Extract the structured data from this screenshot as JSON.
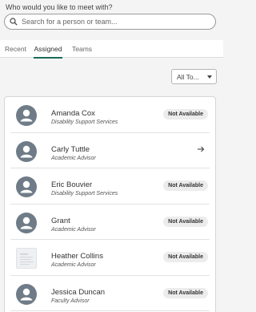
{
  "header": {
    "question": "Who would you like to meet with?"
  },
  "search": {
    "placeholder": "Search for a person or team...",
    "icon": "search-icon"
  },
  "tabs": [
    {
      "label": "Recent",
      "active": false
    },
    {
      "label": "Assigned",
      "active": true
    },
    {
      "label": "Teams",
      "active": false
    }
  ],
  "filter": {
    "value": "All To..."
  },
  "colors": {
    "accent": "#1a6a5a",
    "avatar": "#6f7c88",
    "badge_bg": "#ececec"
  },
  "people": [
    {
      "name": "Amanda Cox",
      "role": "Disability Support Services",
      "status": "Not Available",
      "avatar": "person-icon"
    },
    {
      "name": "Carly Tuttle",
      "role": "Academic Advisor",
      "status": "",
      "action_icon": "arrow-right-icon",
      "avatar": "person-icon"
    },
    {
      "name": "Eric Bouvier",
      "role": "Disability Support Services",
      "status": "Not Available",
      "avatar": "person-icon"
    },
    {
      "name": "Grant",
      "role": "Academic Advisor",
      "status": "Not Available",
      "avatar": "person-icon"
    },
    {
      "name": "Heather Collins",
      "role": "Academic Advisor",
      "status": "Not Available",
      "avatar": "photo"
    },
    {
      "name": "Jessica Duncan",
      "role": "Faculty Advisor",
      "status": "Not Available",
      "avatar": "person-icon"
    }
  ]
}
